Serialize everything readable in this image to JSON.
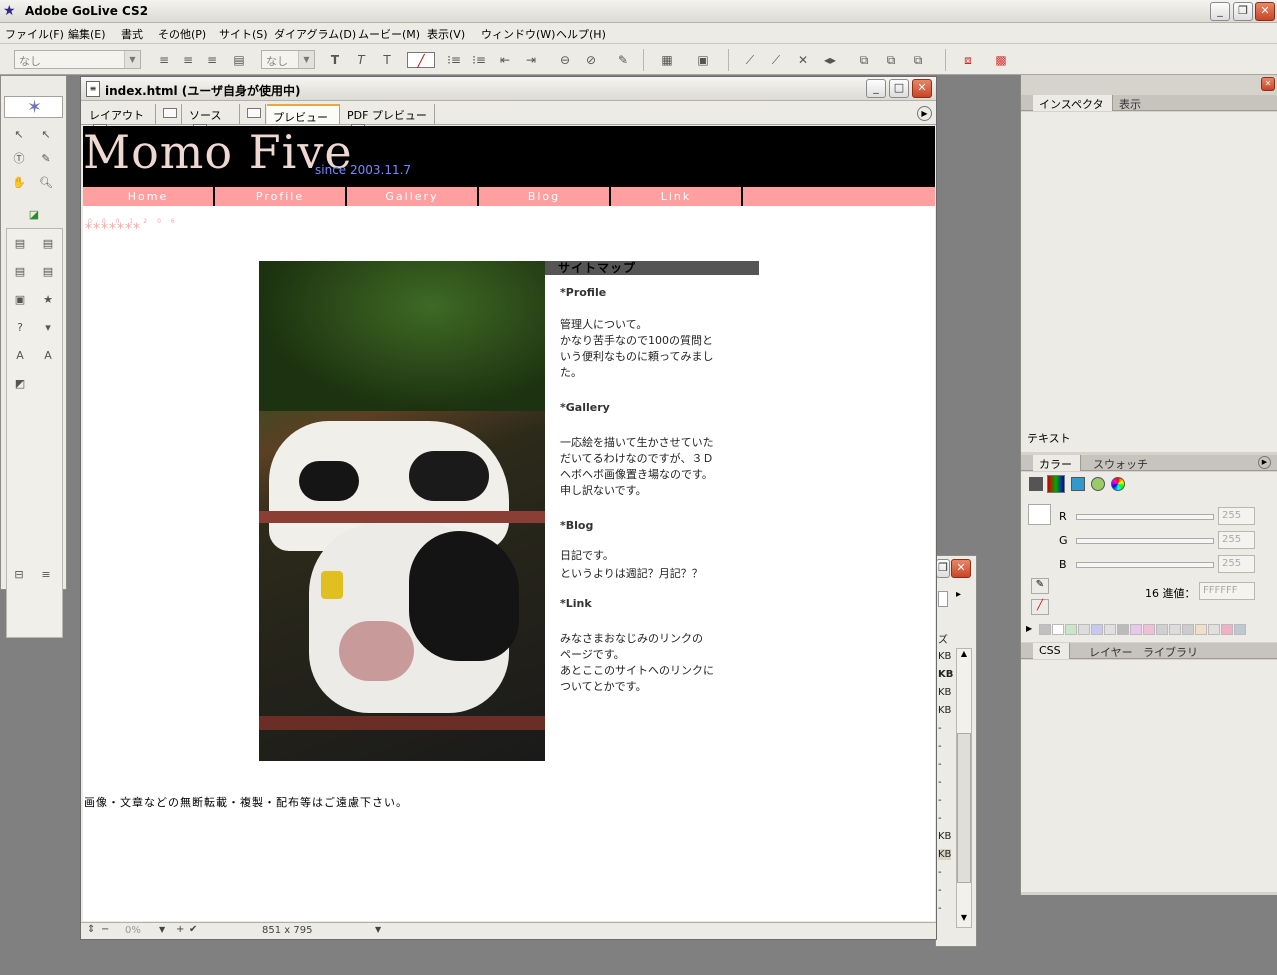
{
  "app": {
    "title": "Adobe GoLive CS2"
  },
  "menu": [
    "ファイル(F)",
    "編集(E)",
    "書式",
    "その他(P)",
    "サイト(S)",
    "ダイアグラム(D)",
    "ムービー(M)",
    "表示(V)",
    "ウィンドウ(W)",
    "ヘルプ(H)"
  ],
  "toolbar": {
    "style_select": "なし",
    "size_select": "なし"
  },
  "document": {
    "title": "index.html (ユーザ自身が使用中)",
    "tabs": [
      "レイアウト",
      "ソース",
      "プレビュー",
      "PDF プレビュー"
    ],
    "status": {
      "zoom": "0%",
      "size": "851 x 795"
    }
  },
  "site": {
    "logo": "Momo Five",
    "since": "since 2003.11.7",
    "nav": [
      "Home",
      "Profile",
      "Gallery",
      "Blog",
      "Link"
    ],
    "counter_digits": "0001206",
    "counter_stars": "*******",
    "sitemap_title": "サイトマップ",
    "sections": [
      {
        "heading": "*Profile",
        "lines": [
          "管理人について。",
          "かなり苦手なので100の質問と",
          "いう便利なものに頼ってみまし",
          "た。"
        ]
      },
      {
        "heading": "*Gallery",
        "lines": [
          "一応絵を描いて生かさせていた",
          "だいてるわけなのですが、３Ｄ",
          "ヘボヘボ画像置き場なのです。",
          "申し訳ないです。"
        ]
      },
      {
        "heading": "*Blog",
        "lines": [
          "日記です。",
          "というよりは週記？月記？？"
        ]
      },
      {
        "heading": "*Link",
        "lines": [
          "みなさまおなじみのリンクの",
          "ページです。",
          "あとここのサイトへのリンクに",
          "ついてとかです。"
        ]
      }
    ],
    "footer": "画像・文章などの無断転載・複製・配布等はご遠慮下さい。"
  },
  "file_panel": {
    "header": "ズ",
    "rows": [
      "KB",
      "KB",
      "KB",
      "KB",
      "-",
      "-",
      "-",
      "-",
      "-",
      "-",
      "KB",
      "KB",
      "-",
      "-",
      "-",
      "-"
    ]
  },
  "inspector": {
    "tabs": [
      "インスペクタ",
      "表示"
    ],
    "label": "テキスト"
  },
  "color_panel": {
    "tabs": [
      "カラー",
      "スウォッチ"
    ],
    "r_label": "R",
    "g_label": "G",
    "b_label": "B",
    "r": "255",
    "g": "255",
    "b": "255",
    "hex_label": "16 進値：",
    "hex": "FFFFFF",
    "swatches": [
      "#c0c0c0",
      "#ffffff",
      "#c8e6c8",
      "#dddddd",
      "#c8c8f0",
      "#e0e0e0",
      "#bbbbbb",
      "#e8c8e8",
      "#f0c0d8",
      "#d0d0d0",
      "#dcdcdc",
      "#cccccc",
      "#f0e0c8",
      "#e0e0e0",
      "#f0b0c8",
      "#c0c8d0"
    ]
  },
  "css_panel": {
    "tabs": [
      "CSS",
      "レイヤー",
      "ライブラリ"
    ]
  },
  "colors": {
    "nav_pink": "#ff9f9f",
    "since_blue": "#7a88ff",
    "close_red": "#d0502e"
  }
}
